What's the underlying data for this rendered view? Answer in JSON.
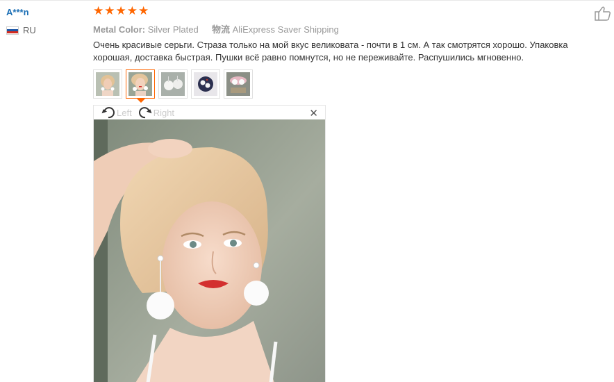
{
  "user": {
    "name": "A***n",
    "country": "RU"
  },
  "rating": {
    "stars": 5,
    "max": 5,
    "color": "#ff6600"
  },
  "meta": {
    "color_label": "Metal Color:",
    "color_value": "Silver Plated",
    "shipping_label": "物流",
    "shipping_value": "AliExpress Saver Shipping"
  },
  "review_text": "Очень красивые серьги. Страза только на мой вкус великовата - почти в 1 см. А так смотрятся хорошо. Упаковка хорошая, доставка быстрая. Пушки всё равно помнутся, но не переживайте. Распушились мгновенно.",
  "thumbnails": [
    {
      "icon": "photo-woman-earrings",
      "active": false
    },
    {
      "icon": "photo-woman-earrings-closeup",
      "active": true
    },
    {
      "icon": "photo-pompom-earrings",
      "active": false
    },
    {
      "icon": "photo-earrings-box",
      "active": false
    },
    {
      "icon": "photo-packaging",
      "active": false
    }
  ],
  "viewer": {
    "rotate_left_label": "Left",
    "rotate_right_label": "Right",
    "close_glyph": "✕"
  },
  "colors": {
    "accent": "#ff6600",
    "username": "#1b6fb5",
    "muted_text": "#999999"
  }
}
